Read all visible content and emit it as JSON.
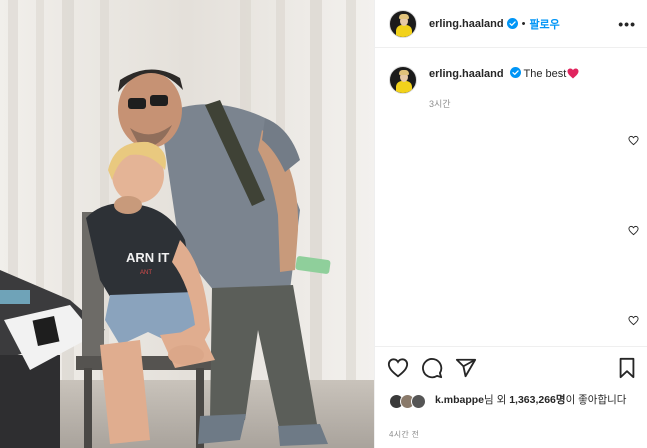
{
  "post": {
    "username": "erling.haaland",
    "dot": "•",
    "follow_label": "팔로우",
    "more_label": "•••",
    "caption": "The best",
    "caption_time": "3시간"
  },
  "likes": {
    "liker": "k.mbappe",
    "suffix_nim": "님",
    "and_word": " 외 ",
    "count": "1,363,266명",
    "tail": "이 좋아합니다"
  },
  "post_time": "4시간 전",
  "photo": {
    "shirt_text": "ARN IT",
    "shirt_subtext": "ANT"
  },
  "colors": {
    "accent": "#0095f6",
    "heart": "#ed4956",
    "text": "#262626",
    "muted": "#8e8e8e"
  },
  "icons": [
    "verified-badge-icon",
    "heart-icon",
    "comment-icon",
    "share-icon",
    "bookmark-icon",
    "more-options-icon"
  ]
}
